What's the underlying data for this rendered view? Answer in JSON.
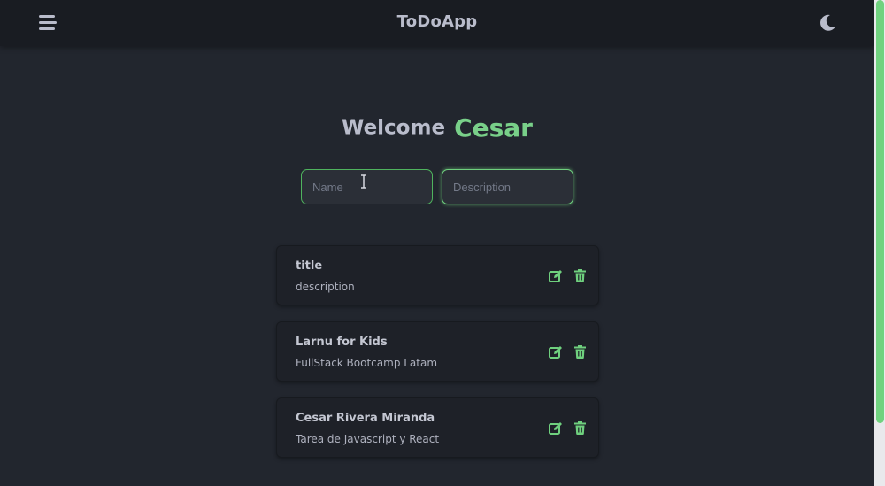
{
  "header": {
    "title": "ToDoApp",
    "menu_icon": "hamburger-menu-icon",
    "theme_icon": "moon-icon"
  },
  "welcome": {
    "label": "Welcome",
    "user_name": "Cesar"
  },
  "form": {
    "name_placeholder": "Name",
    "name_value": "",
    "description_placeholder": "Description",
    "description_value": ""
  },
  "tasks": [
    {
      "title": "title",
      "description": "description"
    },
    {
      "title": "Larnu for Kids",
      "description": "FullStack Bootcamp Latam"
    },
    {
      "title": "Cesar Rivera Miranda",
      "description": "Tarea de Javascript y React"
    }
  ],
  "task_actions": {
    "edit_icon": "edit-icon",
    "delete_icon": "trash-icon"
  },
  "colors": {
    "accent": "#79d089",
    "background": "#22262e",
    "header": "#191c22",
    "card": "#1e2128",
    "text": "#b9bccb"
  }
}
